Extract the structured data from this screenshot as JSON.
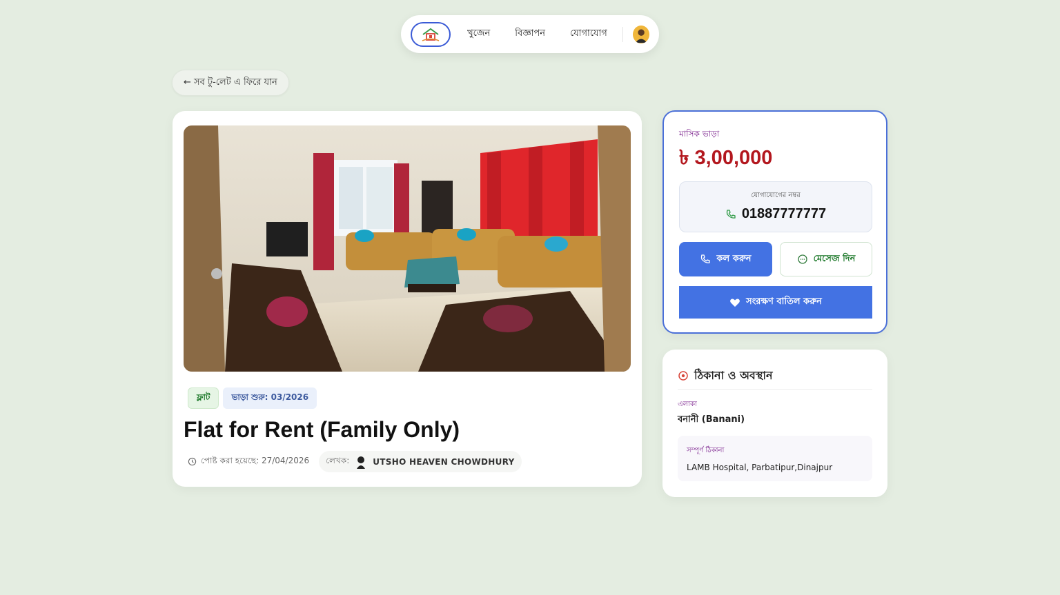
{
  "nav": {
    "links": [
      "খুজেন",
      "বিজ্ঞাপন",
      "যোগাযোগ"
    ]
  },
  "back_label": "← সব টু-লেট এ ফিরে যান",
  "listing": {
    "tag_type": "ফ্লাট",
    "tag_rent_start": "ভাড়া শুরু: 03/2026",
    "title": "Flat for Rent (Family Only)",
    "posted": "পোষ্ট করা হয়েছে: 27/04/2026",
    "author_label": "লেখক:",
    "author_name": "UTSHO HEAVEN CHOWDHURY"
  },
  "price_card": {
    "label": "মাসিক ভাড়া",
    "price": "৳ 3,00,000",
    "contact_label": "যোগাযোগের নম্বর",
    "contact_number": "01887777777",
    "call_label": "কল করুন",
    "message_label": "মেসেজ দিন",
    "unsave_label": "সংরক্ষণ বাতিল করুন"
  },
  "location": {
    "heading": "ঠিকানা ও অবস্থান",
    "area_label": "এলাকা",
    "area_value": "বনানী (Banani)",
    "address_label": "সম্পূর্ণ ঠিকানা",
    "address_value": "LAMB Hospital, Parbatipur,Dinajpur"
  },
  "colors": {
    "accent": "#4372e3",
    "price": "#b3171e",
    "label_purple": "#7a1f8c",
    "background": "#e4ede1"
  }
}
